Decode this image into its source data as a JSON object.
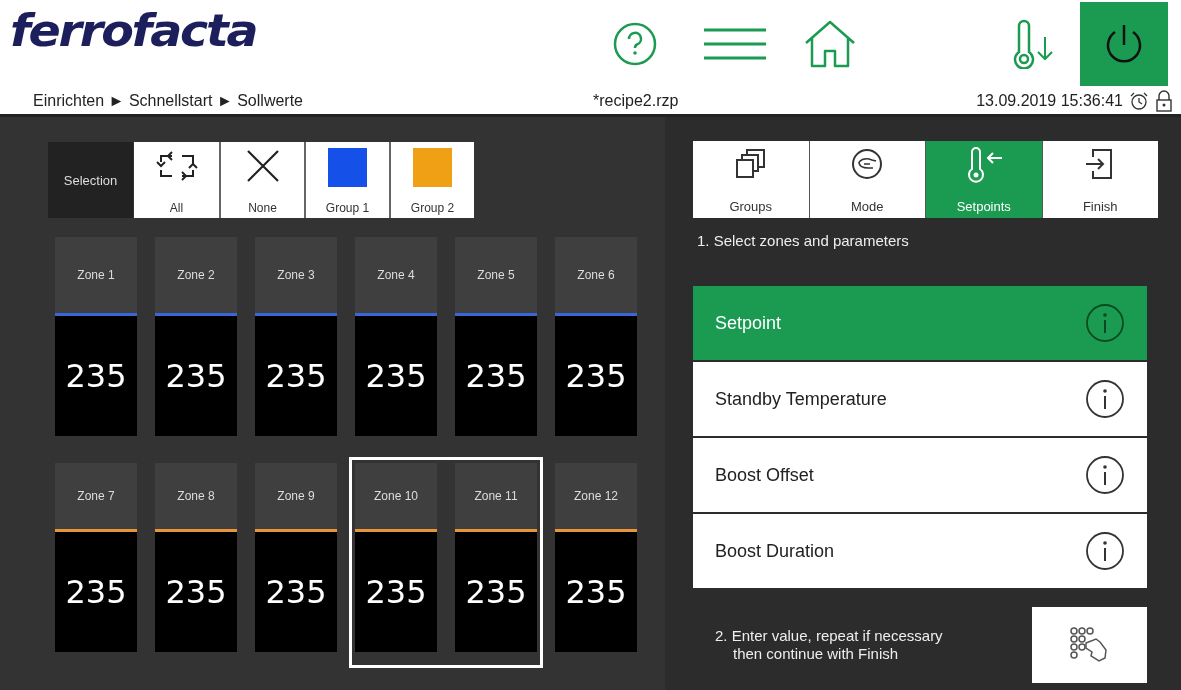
{
  "header": {
    "logo": "ferrofacta",
    "breadcrumb": "Einrichten ► Schnellstart ► Sollwerte",
    "file": "*recipe2.rzp",
    "datetime": "13.09.2019 15:36:41"
  },
  "selection": {
    "label": "Selection",
    "buttons": [
      {
        "kind": "all",
        "label": "All"
      },
      {
        "kind": "none",
        "label": "None"
      },
      {
        "kind": "group",
        "label": "Group 1",
        "color": "#1550e8"
      },
      {
        "kind": "group",
        "label": "Group 2",
        "color": "#f0a014"
      }
    ]
  },
  "zones": [
    {
      "name": "Zone 1",
      "value": "235",
      "color": "#3a66d8",
      "selected": false
    },
    {
      "name": "Zone 2",
      "value": "235",
      "color": "#3a66d8",
      "selected": false
    },
    {
      "name": "Zone 3",
      "value": "235",
      "color": "#3a66d8",
      "selected": false
    },
    {
      "name": "Zone 4",
      "value": "235",
      "color": "#3a66d8",
      "selected": false
    },
    {
      "name": "Zone 5",
      "value": "235",
      "color": "#3a66d8",
      "selected": false
    },
    {
      "name": "Zone 6",
      "value": "235",
      "color": "#3a66d8",
      "selected": false
    },
    {
      "name": "Zone 7",
      "value": "235",
      "color": "#e8943a",
      "selected": false
    },
    {
      "name": "Zone 8",
      "value": "235",
      "color": "#e8943a",
      "selected": false
    },
    {
      "name": "Zone 9",
      "value": "235",
      "color": "#e8943a",
      "selected": false
    },
    {
      "name": "Zone 10",
      "value": "235",
      "color": "#e8943a",
      "selected": true
    },
    {
      "name": "Zone 11",
      "value": "235",
      "color": "#e8943a",
      "selected": true
    },
    {
      "name": "Zone 12",
      "value": "235",
      "color": "#e8943a",
      "selected": false
    }
  ],
  "steps": [
    {
      "kind": "groups",
      "label": "Groups",
      "selected": false
    },
    {
      "kind": "mode",
      "label": "Mode",
      "selected": false
    },
    {
      "kind": "setpoints",
      "label": "Setpoints",
      "selected": true
    },
    {
      "kind": "finish",
      "label": "Finish",
      "selected": false
    }
  ],
  "instruction_1": "1. Select zones and parameters",
  "parameters": [
    {
      "label": "Setpoint",
      "selected": true
    },
    {
      "label": "Standby Temperature",
      "selected": false
    },
    {
      "label": "Boost Offset",
      "selected": false
    },
    {
      "label": "Boost Duration",
      "selected": false
    }
  ],
  "instruction_2": "2. Enter value, repeat if necessary\nthen continue with Finish"
}
